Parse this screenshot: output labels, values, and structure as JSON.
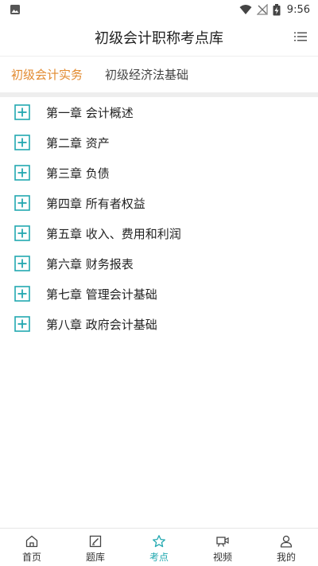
{
  "status_bar": {
    "time": "9:56",
    "icons": [
      "image-icon",
      "wifi-icon",
      "no-signal-icon",
      "battery-charging-icon"
    ]
  },
  "header": {
    "title": "初级会计职称考点库",
    "menu_icon": "list-menu-icon"
  },
  "tabs": [
    {
      "label": "初级会计实务",
      "active": true
    },
    {
      "label": "初级经济法基础",
      "active": false
    }
  ],
  "chapters": [
    {
      "label": "第一章 会计概述"
    },
    {
      "label": "第二章 资产"
    },
    {
      "label": "第三章 负债"
    },
    {
      "label": "第四章 所有者权益"
    },
    {
      "label": "第五章 收入、费用和利润"
    },
    {
      "label": "第六章 财务报表"
    },
    {
      "label": "第七章 管理会计基础"
    },
    {
      "label": "第八章 政府会计基础"
    }
  ],
  "bottom_nav": [
    {
      "label": "首页",
      "icon": "home-icon",
      "active": false
    },
    {
      "label": "题库",
      "icon": "edit-icon",
      "active": false
    },
    {
      "label": "考点",
      "icon": "star-icon",
      "active": true
    },
    {
      "label": "视频",
      "icon": "video-icon",
      "active": false
    },
    {
      "label": "我的",
      "icon": "user-icon",
      "active": false
    }
  ],
  "colors": {
    "accent_tab": "#e28a2f",
    "accent_nav": "#22a8b0",
    "plus_icon": "#22a8b0"
  }
}
